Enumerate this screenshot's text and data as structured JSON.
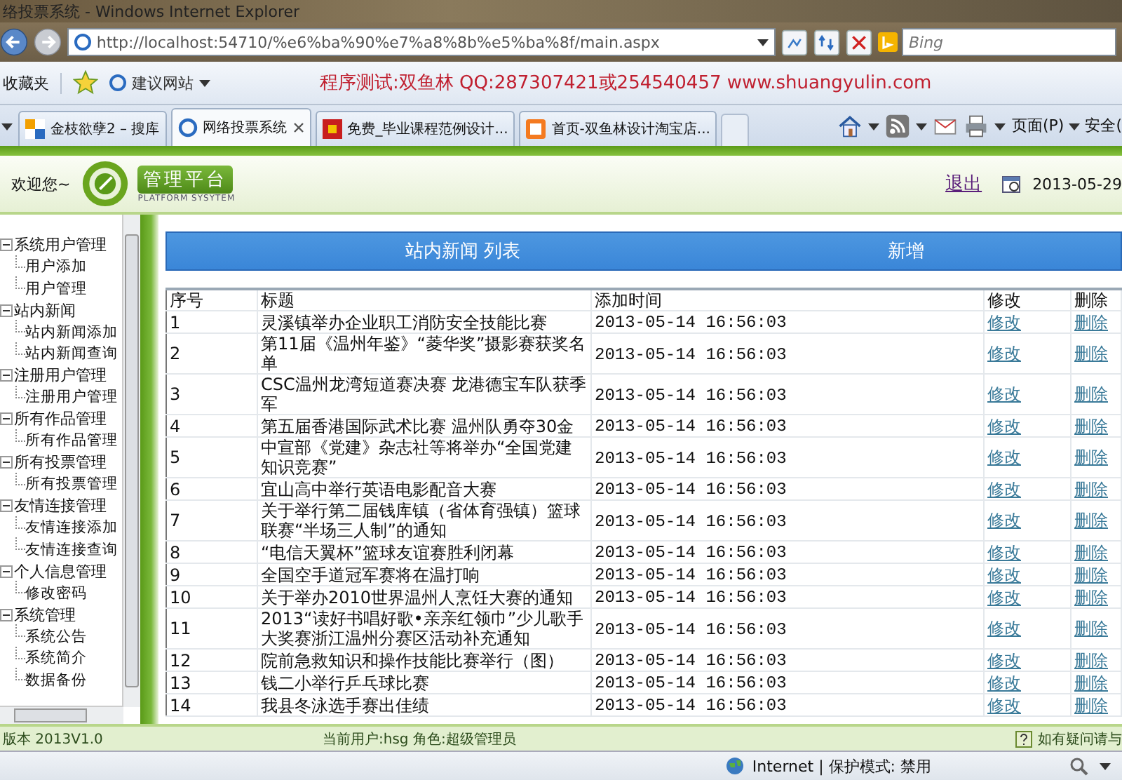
{
  "window": {
    "title": "络投票系统 - Windows Internet Explorer"
  },
  "address_bar": {
    "url": "http://localhost:54710/%e6%ba%90%e7%a8%8b%e5%ba%8f/main.aspx",
    "search_placeholder": "Bing"
  },
  "favorites_bar": {
    "favorites": "收藏夹",
    "suggested_sites": "建议网站",
    "banner": "程序测试:双鱼林 QQ:287307421或254540457 www.shuangyulin.com"
  },
  "tabs": [
    {
      "label": "金枝欲孽2 – 搜库",
      "selected": false
    },
    {
      "label": "网络投票系统",
      "selected": true
    },
    {
      "label": "免费_毕业课程范例设计...",
      "selected": false
    },
    {
      "label": "首页-双鱼林设计淘宝店...",
      "selected": false
    }
  ],
  "command_bar": {
    "page": "页面(P)",
    "safety": "安全("
  },
  "header": {
    "welcome": "欢迎您~",
    "logo_title": "管理平台",
    "logo_subtitle": "PLATFORM SYSYTEM",
    "logout": "退出",
    "date": "2013-05-29"
  },
  "sidebar": {
    "items": [
      {
        "label": "系统用户管理",
        "expanded": true,
        "children": [
          {
            "label": "用户添加"
          },
          {
            "label": "用户管理"
          }
        ]
      },
      {
        "label": "站内新闻",
        "expanded": true,
        "children": [
          {
            "label": "站内新闻添加"
          },
          {
            "label": "站内新闻查询"
          }
        ]
      },
      {
        "label": "注册用户管理",
        "expanded": true,
        "children": [
          {
            "label": "注册用户管理"
          }
        ]
      },
      {
        "label": "所有作品管理",
        "expanded": true,
        "children": [
          {
            "label": "所有作品管理"
          }
        ]
      },
      {
        "label": "所有投票管理",
        "expanded": true,
        "children": [
          {
            "label": "所有投票管理"
          }
        ]
      },
      {
        "label": "友情连接管理",
        "expanded": true,
        "children": [
          {
            "label": "友情连接添加"
          },
          {
            "label": "友情连接查询"
          }
        ]
      },
      {
        "label": "个人信息管理",
        "expanded": true,
        "children": [
          {
            "label": "修改密码"
          }
        ]
      },
      {
        "label": "系统管理",
        "expanded": true,
        "children": [
          {
            "label": "系统公告"
          },
          {
            "label": "系统简介"
          },
          {
            "label": "数据备份"
          }
        ]
      }
    ]
  },
  "news_panel": {
    "title": "站内新闻 列表",
    "add": "新增",
    "columns": [
      "序号",
      "标题",
      "添加时间",
      "修改",
      "删除"
    ],
    "rows": [
      {
        "index": "1",
        "title": "灵溪镇举办企业职工消防安全技能比赛",
        "time": "2013-05-14 16:56:03",
        "edit": "修改",
        "delete": "删除"
      },
      {
        "index": "2",
        "title": "第11届《温州年鉴》“菱华奖”摄影赛获奖名单",
        "time": "2013-05-14 16:56:03",
        "edit": "修改",
        "delete": "删除"
      },
      {
        "index": "3",
        "title": "CSC温州龙湾短道赛决赛 龙港德宝车队获季军",
        "time": "2013-05-14 16:56:03",
        "edit": "修改",
        "delete": "删除"
      },
      {
        "index": "4",
        "title": "第五届香港国际武术比赛 温州队勇夺30金",
        "time": "2013-05-14 16:56:03",
        "edit": "修改",
        "delete": "删除"
      },
      {
        "index": "5",
        "title": "中宣部《党建》杂志社等将举办“全国党建知识竞赛”",
        "time": "2013-05-14 16:56:03",
        "edit": "修改",
        "delete": "删除"
      },
      {
        "index": "6",
        "title": "宜山高中举行英语电影配音大赛",
        "time": "2013-05-14 16:56:03",
        "edit": "修改",
        "delete": "删除"
      },
      {
        "index": "7",
        "title": "关于举行第二届钱库镇（省体育强镇）篮球联赛“半场三人制”的通知",
        "time": "2013-05-14 16:56:03",
        "edit": "修改",
        "delete": "删除"
      },
      {
        "index": "8",
        "title": "“电信天翼杯”篮球友谊赛胜利闭幕",
        "time": "2013-05-14 16:56:03",
        "edit": "修改",
        "delete": "删除"
      },
      {
        "index": "9",
        "title": "全国空手道冠军赛将在温打响",
        "time": "2013-05-14 16:56:03",
        "edit": "修改",
        "delete": "删除"
      },
      {
        "index": "10",
        "title": "关于举办2010世界温州人烹饪大赛的通知",
        "time": "2013-05-14 16:56:03",
        "edit": "修改",
        "delete": "删除"
      },
      {
        "index": "11",
        "title": "2013“读好书唱好歌•亲亲红领巾”少儿歌手大奖赛浙江温州分赛区活动补充通知",
        "time": "2013-05-14 16:56:03",
        "edit": "修改",
        "delete": "删除"
      },
      {
        "index": "12",
        "title": "院前急救知识和操作技能比赛举行（图）",
        "time": "2013-05-14 16:56:03",
        "edit": "修改",
        "delete": "删除"
      },
      {
        "index": "13",
        "title": "钱二小举行乒乓球比赛",
        "time": "2013-05-14 16:56:03",
        "edit": "修改",
        "delete": "删除"
      },
      {
        "index": "14",
        "title": "我县冬泳选手赛出佳绩",
        "time": "2013-05-14 16:56:03",
        "edit": "修改",
        "delete": "删除"
      }
    ]
  },
  "footer": {
    "version": "版本 2013V1.0",
    "user": "当前用户:hsg 角色:超级管理员",
    "help": "如有疑问请与"
  },
  "status_bar": {
    "zone": "Internet | 保护模式: 禁用"
  }
}
